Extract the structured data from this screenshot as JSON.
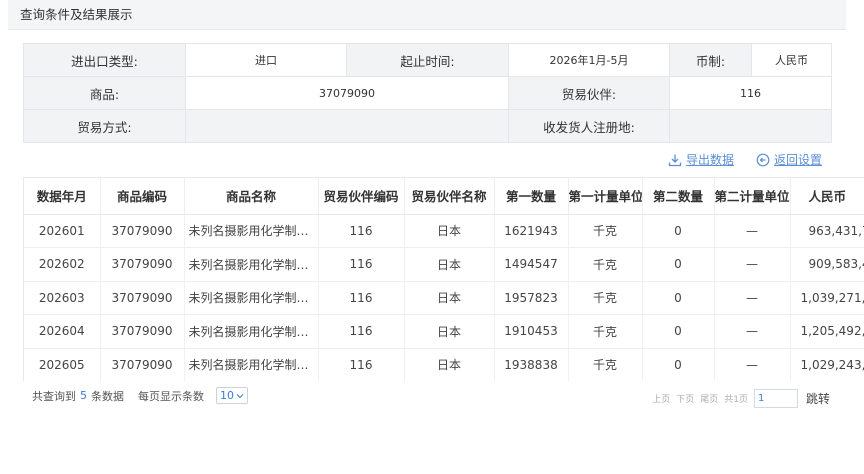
{
  "panel": {
    "title": "查询条件及结果展示"
  },
  "conditions": {
    "trade_type_label": "进出口类型:",
    "trade_type_value": "进口",
    "period_label": "起止时间:",
    "period_value": "2026年1月-5月",
    "currency_label": "币制:",
    "currency_value": "人民币",
    "goods_label": "商品:",
    "goods_value": "37079090",
    "partner_label": "贸易伙伴:",
    "partner_value": "116",
    "trade_mode_label": "贸易方式:",
    "trade_mode_value": "",
    "consignee_label": "收发货人注册地:",
    "consignee_value": ""
  },
  "actions": {
    "export_label": "导出数据",
    "export_icon": "download-icon",
    "back_label": "返回设置",
    "back_icon": "back-arrow-circle-icon"
  },
  "table": {
    "headers": [
      "数据年月",
      "商品编码",
      "商品名称",
      "贸易伙伴编码",
      "贸易伙伴名称",
      "第一数量",
      "第一计量单位",
      "第二数量",
      "第二计量单位",
      "人民币"
    ],
    "rows": [
      [
        "202601",
        "37079090",
        "未列名摄影用化学制剂...",
        "116",
        "日本",
        "1621943",
        "千克",
        "0",
        "—",
        "963,431,7"
      ],
      [
        "202602",
        "37079090",
        "未列名摄影用化学制剂...",
        "116",
        "日本",
        "1494547",
        "千克",
        "0",
        "—",
        "909,583,4"
      ],
      [
        "202603",
        "37079090",
        "未列名摄影用化学制剂...",
        "116",
        "日本",
        "1957823",
        "千克",
        "0",
        "—",
        "1,039,271,"
      ],
      [
        "202604",
        "37079090",
        "未列名摄影用化学制剂...",
        "116",
        "日本",
        "1910453",
        "千克",
        "0",
        "—",
        "1,205,492,"
      ],
      [
        "202605",
        "37079090",
        "未列名摄影用化学制剂...",
        "116",
        "日本",
        "1938838",
        "千克",
        "0",
        "—",
        "1,029,243,"
      ]
    ]
  },
  "footer": {
    "total_prefix": "共查询到",
    "total_count": "5",
    "total_suffix": "条数据",
    "page_size_label": "每页显示条数",
    "page_size_value": "10",
    "first_page": "上页",
    "next_page": "下页",
    "last_page": "尾页",
    "page_total": "共1页",
    "page_input_value": "1",
    "jump_label": "跳转"
  }
}
